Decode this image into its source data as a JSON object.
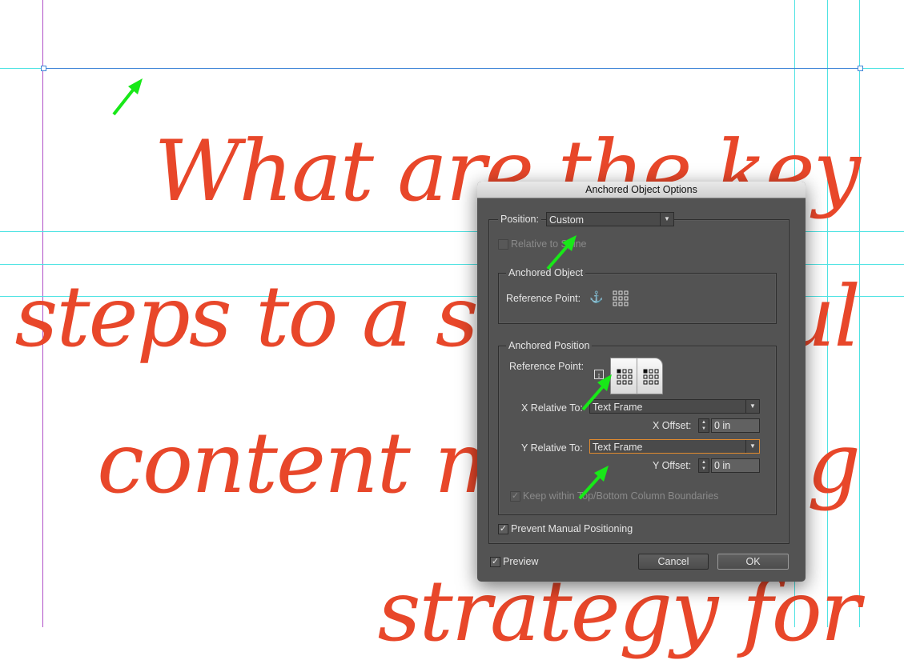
{
  "document": {
    "heading_lines": [
      "What are the key",
      "steps to a successful",
      "content marketing",
      "strategy for"
    ]
  },
  "dialog": {
    "title": "Anchored Object Options",
    "position_label": "Position:",
    "position_value": "Custom",
    "relative_to_spine": "Relative to Spine",
    "anchored_object_legend": "Anchored Object",
    "anchored_object_ref_label": "Reference Point:",
    "anchored_position_legend": "Anchored Position",
    "anchored_position_ref_label": "Reference Point:",
    "x_relative_label": "X Relative To:",
    "x_relative_value": "Text Frame",
    "x_offset_label": "X Offset:",
    "x_offset_value": "0 in",
    "y_relative_label": "Y Relative To:",
    "y_relative_value": "Text Frame",
    "y_offset_label": "Y Offset:",
    "y_offset_value": "0 in",
    "keep_within": "Keep within Top/Bottom Column Boundaries",
    "prevent_manual": "Prevent Manual Positioning",
    "preview": "Preview",
    "cancel": "Cancel",
    "ok": "OK"
  },
  "colors": {
    "heading": "#e8472a",
    "guide": "#4fe3e3",
    "arrow": "#18e818"
  }
}
